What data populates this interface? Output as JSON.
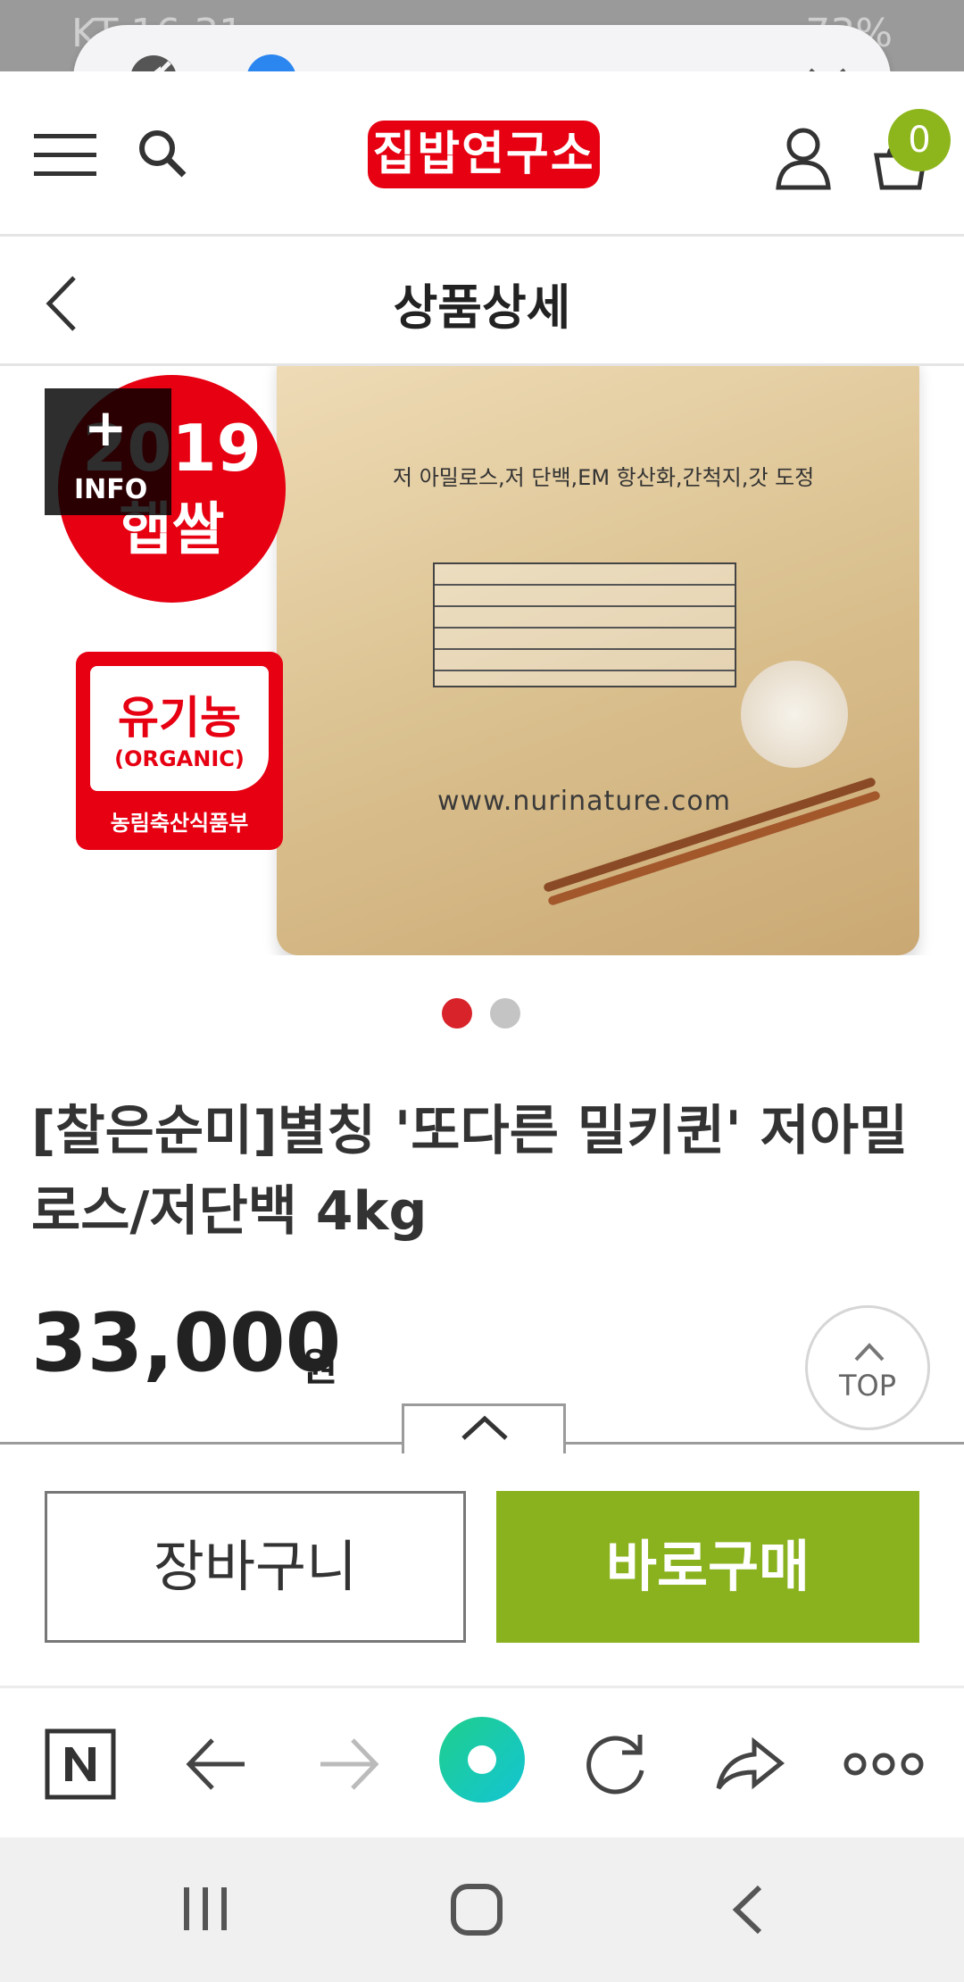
{
  "status_bar": {
    "carrier": "KT",
    "time": "16:31",
    "battery": "73%"
  },
  "media_overlay": {
    "progress": 0.05
  },
  "header": {
    "logo": "집밥연구소",
    "cart_count": "0"
  },
  "page": {
    "title": "상품상세"
  },
  "product_image": {
    "badge_year": "2019",
    "badge_text": "햅쌀",
    "info_label": "INFO",
    "organic_ko": "유기농",
    "organic_en": "(ORGANIC)",
    "organic_ministry": "농림축산식품부",
    "bag_subtitle": "저 아밀로스,저 단백,EM 항산화,간척지,갓 도정",
    "bag_url": "www.nurinature.com",
    "carousel": {
      "count": 2,
      "active": 1
    }
  },
  "product": {
    "name": "[찰은순미]별칭 '또다른 밀키퀸' 저아밀로스/저단백 4kg",
    "price": "33,000",
    "currency": "원"
  },
  "buttons": {
    "top": "TOP",
    "cart": "장바구니",
    "buy": "바로구매"
  },
  "colors": {
    "brand_red": "#e60012",
    "buy_green": "#8ab21e",
    "badge_green": "#8db51c"
  }
}
